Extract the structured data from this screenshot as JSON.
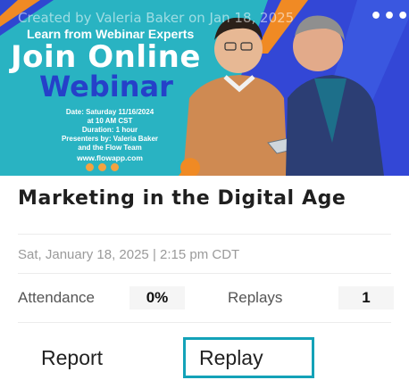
{
  "banner": {
    "created_by": "Created by Valeria Baker on Jan 18, 2025",
    "more_icon": "more-horizontal-icon",
    "tagline": "Learn from Webinar Experts",
    "headline_1": "Join Online",
    "headline_2": "Webinar",
    "details": [
      "Date: Saturday  11/16/2024",
      "at 10 AM CST",
      "Duration: 1 hour",
      "Presenters by: Valeria Baker",
      "and the Flow Team"
    ],
    "website": "www.flowapp.com",
    "colors": {
      "background": "#29b3c2",
      "headline_accent": "#2541c9",
      "stripe": "#f08a24",
      "shape": "#3347d6"
    }
  },
  "event": {
    "title": "Marketing in the Digital Age",
    "datetime": "Sat, January 18, 2025 | 2:15 pm CDT"
  },
  "stats": {
    "attendance_label": "Attendance",
    "attendance_value": "0%",
    "replays_label": "Replays",
    "replays_value": "1"
  },
  "actions": {
    "report_label": "Report",
    "replay_label": "Replay",
    "active_border_color": "#13a2b8"
  }
}
